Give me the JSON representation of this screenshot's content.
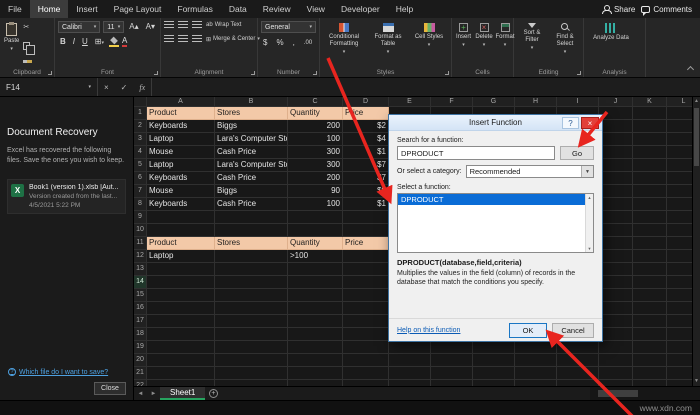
{
  "ribbon_tabs": {
    "items": [
      "File",
      "Home",
      "Insert",
      "Page Layout",
      "Formulas",
      "Data",
      "Review",
      "View",
      "Developer",
      "Help"
    ],
    "active_tab": "Home",
    "share": "Share",
    "comments": "Comments"
  },
  "ribbon": {
    "clipboard": {
      "label": "Clipboard",
      "paste": "Paste"
    },
    "font": {
      "label": "Font",
      "name": "Calibri",
      "size": "11"
    },
    "alignment": {
      "label": "Alignment",
      "wrap": "Wrap Text",
      "merge": "Merge & Center"
    },
    "number": {
      "label": "Number",
      "format": "General"
    },
    "styles": {
      "label": "Styles",
      "conditional": "Conditional Formatting",
      "format_table": "Format as Table",
      "cell_styles": "Cell Styles"
    },
    "cells": {
      "label": "Cells",
      "insert": "Insert",
      "del": "Delete",
      "format": "Format"
    },
    "editing": {
      "label": "Editing",
      "sort": "Sort & Filter",
      "find": "Find & Select"
    },
    "analysis": {
      "label": "Analysis",
      "analyze": "Analyze Data"
    }
  },
  "formula_bar": {
    "name_box": "F14"
  },
  "document_recovery": {
    "title": "Document Recovery",
    "description": "Excel has recovered the following files. Save the ones you wish to keep.",
    "file_name": "Book1 (version 1).xlsb [Aut...",
    "file_detail": "Version created from the last...",
    "file_time": "4/5/2021 5:22 PM",
    "link": "Which file do I want to save?",
    "close": "Close"
  },
  "spreadsheet": {
    "visible_columns": [
      "A",
      "B",
      "C",
      "D",
      "E",
      "F",
      "G",
      "H",
      "I",
      "J",
      "K",
      "L"
    ],
    "visible_rows": 22,
    "table": [
      {
        "row": 1,
        "fill": "peach",
        "cells": {
          "A": "Product",
          "B": "Stores",
          "C": "Quantity",
          "D": "Price"
        }
      },
      {
        "row": 2,
        "cells": {
          "A": "Keyboards",
          "B": "Biggs",
          "C": "200",
          "D": "$2"
        }
      },
      {
        "row": 3,
        "cells": {
          "A": "Laptop",
          "B": "Lara's Computer Store",
          "C": "100",
          "D": "$4"
        }
      },
      {
        "row": 4,
        "cells": {
          "A": "Mouse",
          "B": "Cash Price",
          "C": "300",
          "D": "$1"
        }
      },
      {
        "row": 5,
        "cells": {
          "A": "Laptop",
          "B": "Lara's Computer Store",
          "C": "300",
          "D": "$7"
        }
      },
      {
        "row": 6,
        "cells": {
          "A": "Keyboards",
          "B": "Cash Price",
          "C": "200",
          "D": "$7"
        }
      },
      {
        "row": 7,
        "cells": {
          "A": "Mouse",
          "B": "Biggs",
          "C": "90",
          "D": "$9"
        }
      },
      {
        "row": 8,
        "cells": {
          "A": "Keyboards",
          "B": "Cash Price",
          "C": "100",
          "D": "$1"
        }
      },
      {
        "row": 11,
        "fill": "peach",
        "cells": {
          "A": "Product",
          "B": "Stores",
          "C": "Quantity",
          "D": "Price"
        }
      },
      {
        "row": 12,
        "cells": {
          "A": "Laptop",
          "C": ">100"
        }
      }
    ]
  },
  "dialog": {
    "title": "Insert Function",
    "search_label": "Search for a function:",
    "search_value": "DPRODUCT",
    "go": "Go",
    "category_label": "Or select a category:",
    "category_value": "Recommended",
    "select_label": "Select a function:",
    "functions": [
      "DPRODUCT"
    ],
    "signature": "DPRODUCT(database,field,criteria)",
    "description": "Multiplies the values in the field (column) of records in the database that match the conditions you specify.",
    "help_link": "Help on this function",
    "ok": "OK",
    "cancel": "Cancel"
  },
  "sheet_tabs": {
    "items": [
      "Sheet1"
    ]
  },
  "status_bar": {
    "watermark": "www.xdn.com"
  }
}
